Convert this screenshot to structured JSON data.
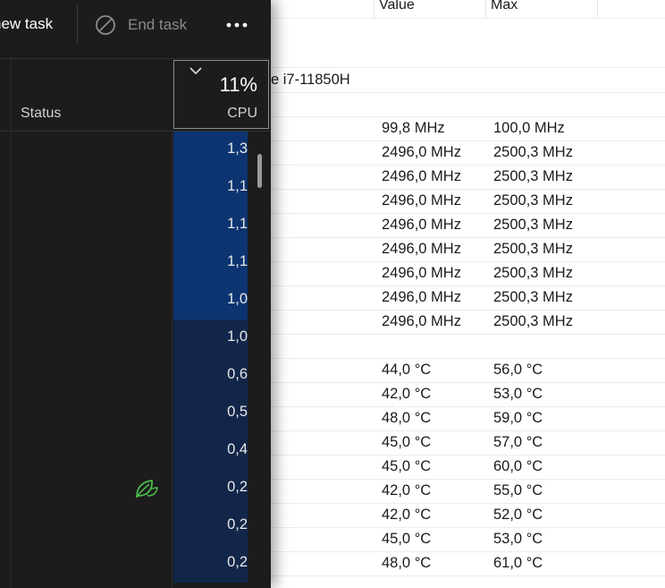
{
  "task_manager": {
    "toolbar": {
      "run_new_task": "new task",
      "end_task": "End task",
      "more": "•••"
    },
    "columns": {
      "status": "Status",
      "cpu_percent": "11%",
      "cpu_label": "CPU"
    },
    "cpu_values": [
      "1,3",
      "1,1",
      "1,1",
      "1,1",
      "1,0",
      "1,0",
      "0,6",
      "0,5",
      "0,4",
      "0,2",
      "0,2",
      "0,2"
    ],
    "colors": {
      "heat_high": "#0c3470",
      "heat_low": "#12264a",
      "leaf": "#4fbf4f"
    }
  },
  "sensors": {
    "headers": {
      "value": "Value",
      "max": "Max"
    },
    "cpu_name_fragment": "e i7-11850H",
    "clock_rows": [
      {
        "value": "99,8 MHz",
        "max": "100,0 MHz"
      },
      {
        "value": "2496,0 MHz",
        "max": "2500,3 MHz"
      },
      {
        "value": "2496,0 MHz",
        "max": "2500,3 MHz"
      },
      {
        "value": "2496,0 MHz",
        "max": "2500,3 MHz"
      },
      {
        "value": "2496,0 MHz",
        "max": "2500,3 MHz"
      },
      {
        "value": "2496,0 MHz",
        "max": "2500,3 MHz"
      },
      {
        "value": "2496,0 MHz",
        "max": "2500,3 MHz"
      },
      {
        "value": "2496,0 MHz",
        "max": "2500,3 MHz"
      },
      {
        "value": "2496,0 MHz",
        "max": "2500,3 MHz"
      }
    ],
    "temp_rows": [
      {
        "value": "44,0 °C",
        "max": "56,0 °C"
      },
      {
        "value": "42,0 °C",
        "max": "53,0 °C"
      },
      {
        "value": "48,0 °C",
        "max": "59,0 °C"
      },
      {
        "value": "45,0 °C",
        "max": "57,0 °C"
      },
      {
        "value": "45,0 °C",
        "max": "60,0 °C"
      },
      {
        "value": "42,0 °C",
        "max": "55,0 °C"
      },
      {
        "value": "42,0 °C",
        "max": "52,0 °C"
      },
      {
        "value": "45,0 °C",
        "max": "53,0 °C"
      },
      {
        "value": "48,0 °C",
        "max": "61,0 °C"
      }
    ]
  }
}
